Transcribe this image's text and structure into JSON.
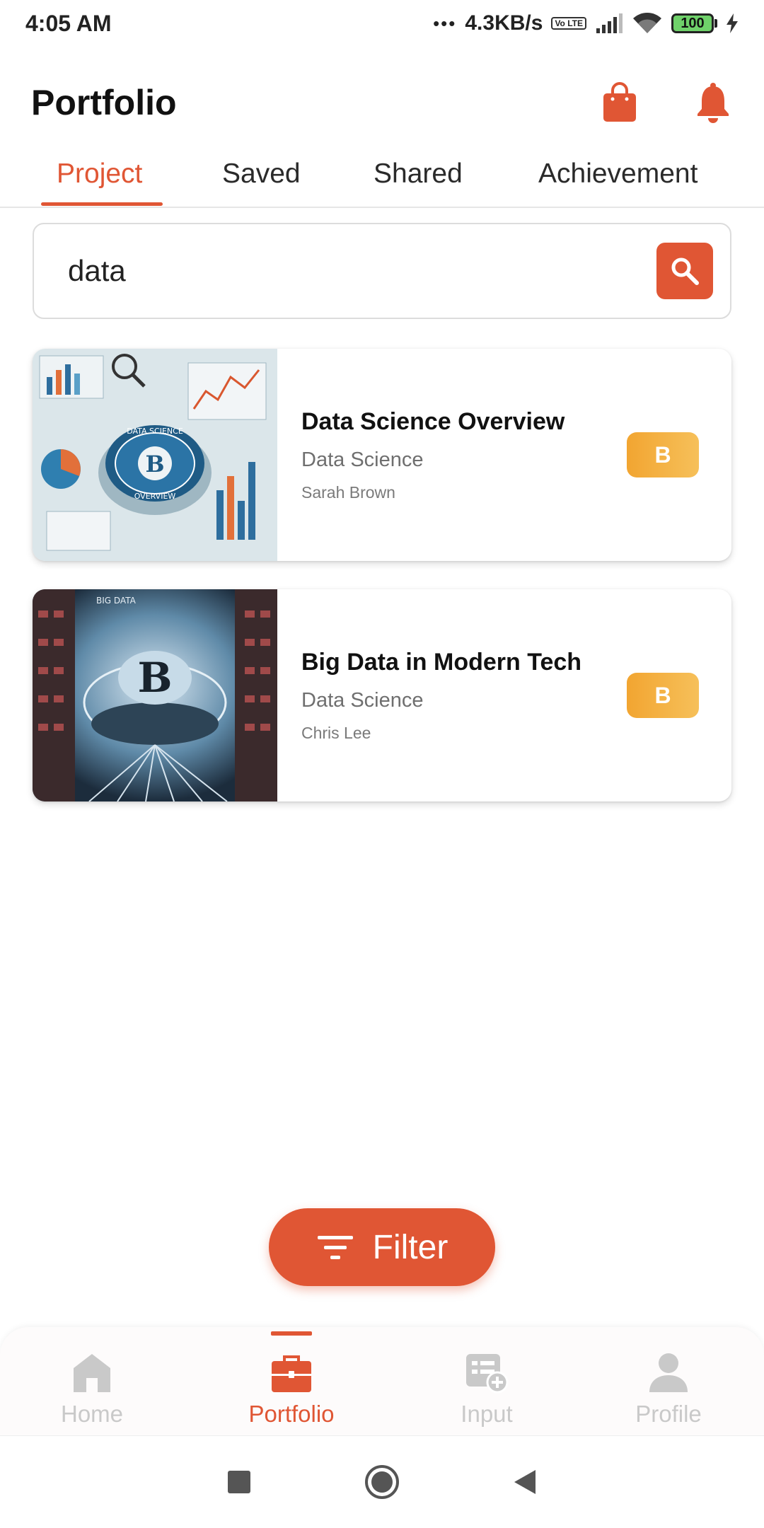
{
  "status_bar": {
    "time": "4:05 AM",
    "dots": "•••",
    "network_speed": "4.3KB/s",
    "volte": "Vo LTE",
    "battery": "100"
  },
  "header": {
    "title": "Portfolio",
    "icons": [
      "shopping-bag-icon",
      "bell-icon"
    ],
    "accent_color": "#e05634"
  },
  "tabs": [
    {
      "label": "Project",
      "active": true
    },
    {
      "label": "Saved",
      "active": false
    },
    {
      "label": "Shared",
      "active": false
    },
    {
      "label": "Achievement",
      "active": false
    }
  ],
  "search": {
    "value": "data",
    "placeholder": ""
  },
  "projects": [
    {
      "title": "Data Science Overview",
      "category": "Data Science",
      "author": "Sarah Brown",
      "badge": "B",
      "thumbnail_text": [
        "DATA SCIENCE",
        "OVERVIEW",
        "B"
      ]
    },
    {
      "title": "Big Data in Modern Tech",
      "category": "Data Science",
      "author": "Chris Lee",
      "badge": "B",
      "thumbnail_text": [
        "BIG DATA",
        "B"
      ]
    }
  ],
  "filter_button": {
    "label": "Filter"
  },
  "bottom_nav": [
    {
      "label": "Home",
      "icon": "home-icon",
      "active": false
    },
    {
      "label": "Portfolio",
      "icon": "briefcase-icon",
      "active": true
    },
    {
      "label": "Input",
      "icon": "add-document-icon",
      "active": false
    },
    {
      "label": "Profile",
      "icon": "person-icon",
      "active": false
    }
  ],
  "system_nav": [
    "recents-square-icon",
    "home-circle-icon",
    "back-triangle-icon"
  ]
}
